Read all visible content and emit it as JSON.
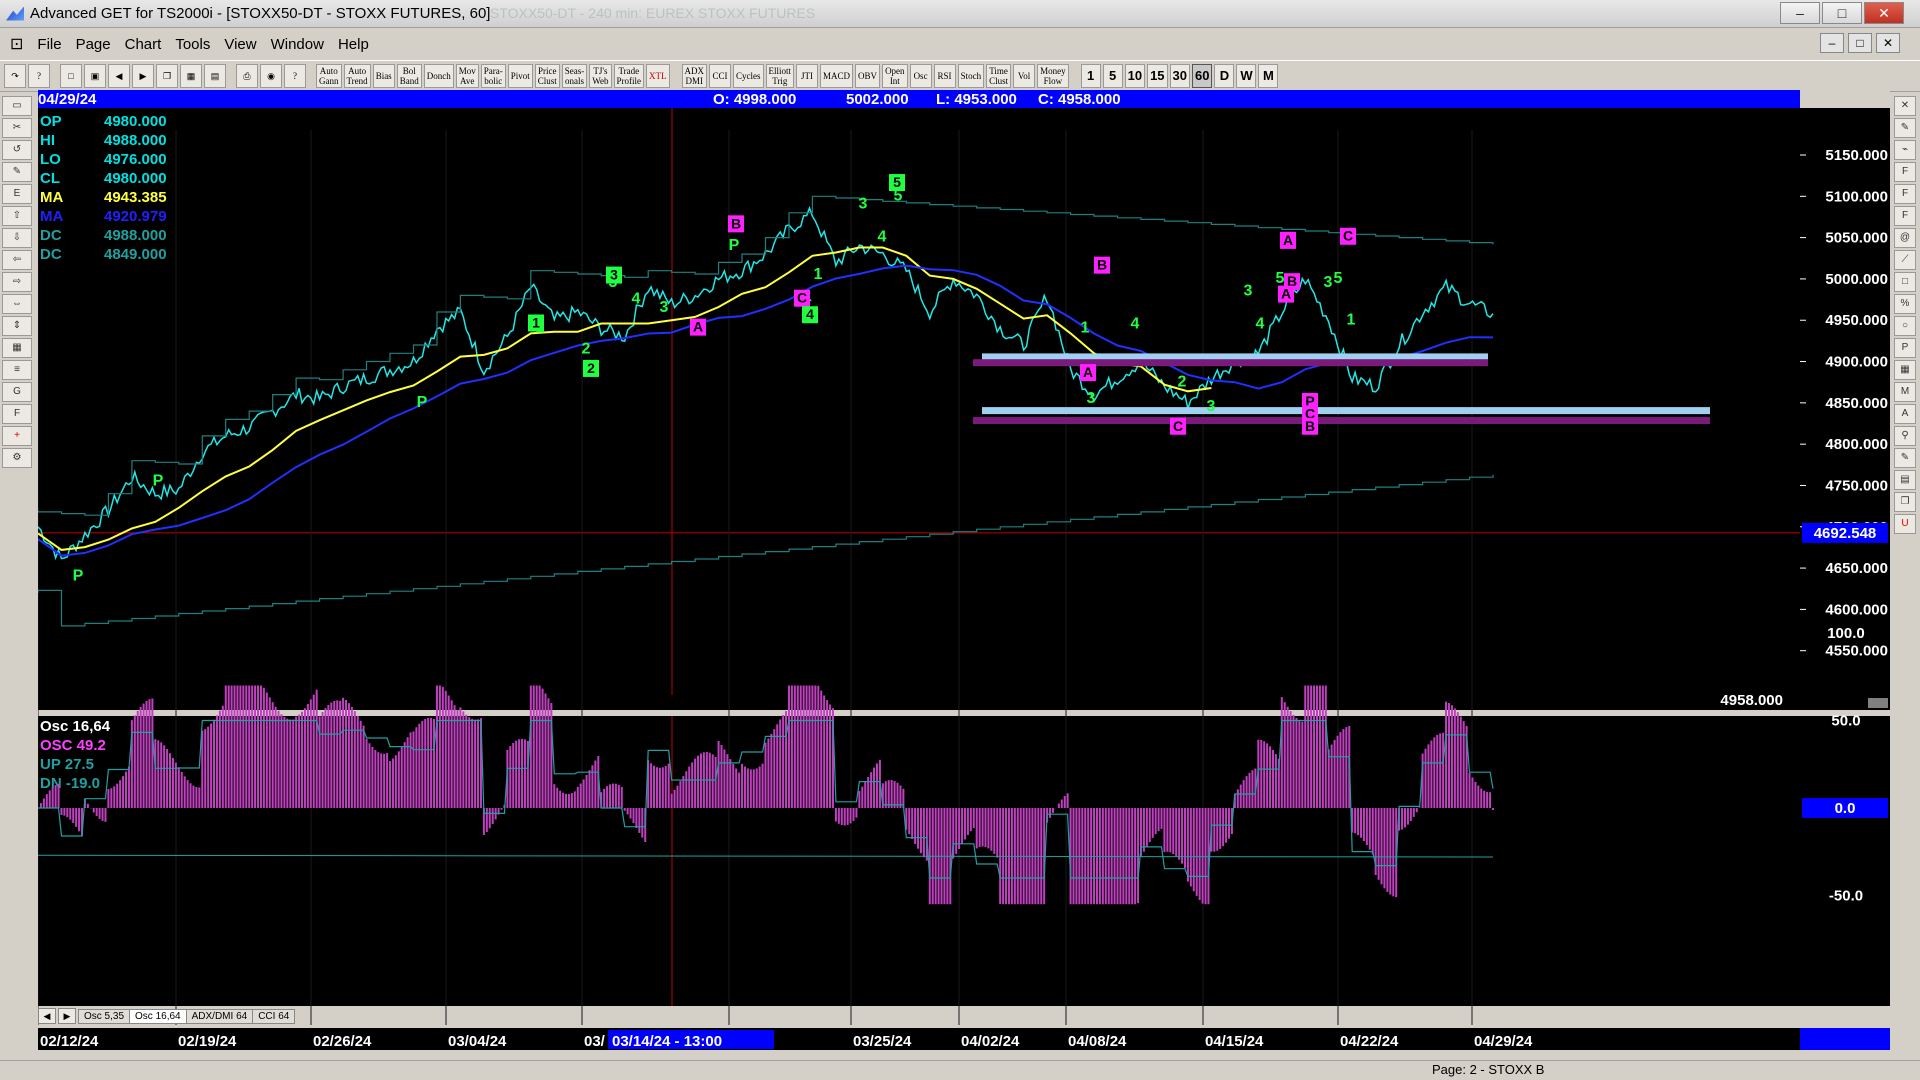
{
  "window": {
    "title": "Advanced GET for TS2000i - [STOXX50-DT - STOXX FUTURES, 60]",
    "ghost_title": "STOXX50-DT - 240 min: EUREX STOXX FUTURES"
  },
  "menu": [
    "File",
    "Page",
    "Chart",
    "Tools",
    "View",
    "Window",
    "Help"
  ],
  "toolbar": {
    "studies": [
      "Auto\nGann",
      "Auto\nTrend",
      "Bias",
      "Bol\nBand",
      "Donch",
      "Mov\nAve",
      "Para-\nbolic",
      "Pivot",
      "Price\nClust",
      "Seas-\nonals",
      "TJ's\nWeb",
      "Trade\nProfile",
      "XTL",
      "ADX\nDMI",
      "CCI",
      "Cycles",
      "Elliott\nTrig",
      "JTI",
      "MACD",
      "OBV",
      "Open\nInt",
      "Osc",
      "RSI",
      "Stoch",
      "Time\nClust",
      "Vol",
      "Money\nFlow"
    ],
    "timeframes": [
      "1",
      "5",
      "10",
      "15",
      "30",
      "60",
      "D",
      "W",
      "M"
    ],
    "selected_timeframe": "60"
  },
  "header": {
    "date": "04/29/24",
    "open": "O: 4998.000",
    "high": "5002.000",
    "low": "L: 4953.000",
    "close": "C: 4958.000",
    "bar_color": "#0000ff"
  },
  "legend": [
    {
      "label": "OP",
      "value": "4980.000",
      "color": "#00e0e0"
    },
    {
      "label": "HI",
      "value": "4988.000",
      "color": "#00e0e0"
    },
    {
      "label": "LO",
      "value": "4976.000",
      "color": "#00e0e0"
    },
    {
      "label": "CL",
      "value": "4980.000",
      "color": "#00e0e0"
    },
    {
      "label": "MA",
      "value": "4943.385",
      "color": "#ffff40"
    },
    {
      "label": "MA",
      "value": "4920.979",
      "color": "#2020ff"
    },
    {
      "label": "DC",
      "value": "4988.000",
      "color": "#20a0a0"
    },
    {
      "label": "DC",
      "value": "4849.000",
      "color": "#20a0a0"
    }
  ],
  "osc_legend": [
    {
      "label": "Osc 16,64",
      "color": "#ffffff"
    },
    {
      "label": "OSC 49.2",
      "color": "#ff40ff"
    },
    {
      "label": "UP  27.5",
      "color": "#20a0a0"
    },
    {
      "label": "DN  -19.0",
      "color": "#20a0a0"
    }
  ],
  "price_axis": [
    "5150.000",
    "5100.000",
    "5050.000",
    "5000.000",
    "4950.000",
    "4900.000",
    "4850.000",
    "4800.000",
    "4750.000",
    "4700.000",
    "4650.000",
    "4600.000",
    "4550.000"
  ],
  "price_cursor_label": "4692.548",
  "price_last_label": "4958.000",
  "osc_axis": [
    "100.0",
    "50.0",
    "0.0",
    "-50.0"
  ],
  "date_axis": [
    "02/12/24",
    "02/19/24",
    "02/26/24",
    "03/04/24",
    "03/",
    "/18/24",
    "03/25/24",
    "04/02/24",
    "04/08/24",
    "04/15/24",
    "04/22/24",
    "04/29/24"
  ],
  "cursor_date": "03/14/24 - 13:00",
  "osc_tabs": [
    "Osc 5,35",
    "Osc 16,64",
    "ADX/DMI 64",
    "CCI 64"
  ],
  "active_osc_tab": "Osc 16,64",
  "status": "Page: 2 - STOXX B",
  "wave_labels_green": [
    "P",
    "P",
    "P",
    "1",
    "2",
    "3",
    "3",
    "4",
    "5",
    "P",
    "1",
    "2",
    "3",
    "4",
    "4",
    "5",
    "1",
    "2",
    "3",
    "4",
    "3",
    "4",
    "5",
    "3",
    "4",
    "1",
    "2",
    "P",
    "P"
  ],
  "wave_labels_magenta": [
    "B",
    "C",
    "A",
    "B",
    "A",
    "A",
    "B",
    "C",
    "A",
    "B",
    "C",
    "C",
    "B",
    "P",
    "C"
  ],
  "chart_data": {
    "type": "line",
    "series": [
      {
        "name": "STOXX50-DT",
        "values": [
          4700,
          4660,
          4690,
          4720,
          4760,
          4740,
          4745,
          4790,
          4810,
          4820,
          4840,
          4860,
          4855,
          4870,
          4880,
          4890,
          4900,
          4940,
          4960,
          4890,
          4930,
          4990,
          4950,
          4960,
          4940,
          4930,
          4990,
          4970,
          4980,
          5000,
          5010,
          5030,
          5060,
          5080,
          5020,
          5040,
          5030,
          5010,
          4960,
          5000,
          4980,
          4940,
          4920,
          4980,
          4890,
          4860,
          4880,
          4900,
          4870,
          4850,
          4880,
          4900,
          4910,
          4960,
          5000,
          4950,
          4880,
          4870,
          4920,
          4960,
          4990,
          4970,
          4958
        ]
      }
    ],
    "ylim": [
      4500,
      5170
    ]
  }
}
